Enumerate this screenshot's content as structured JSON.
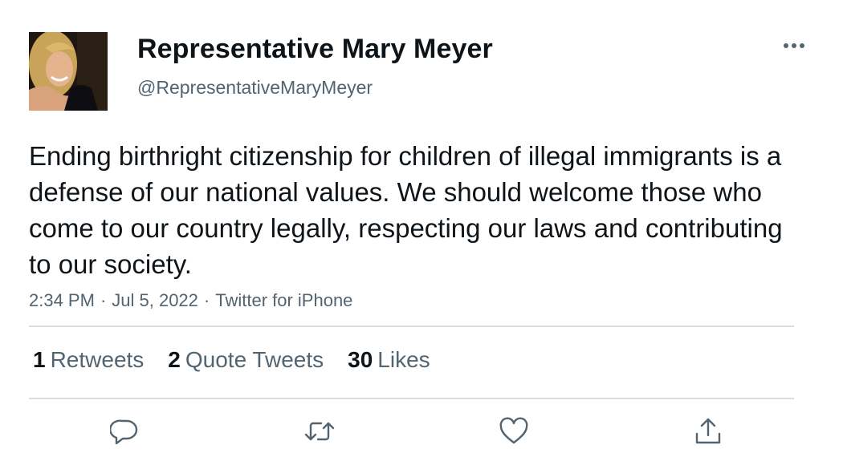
{
  "author": {
    "display_name": "Representative Mary Meyer",
    "handle": "@RepresentativeMaryMeyer",
    "avatar_icon": "profile-photo"
  },
  "tweet": {
    "text": "Ending birthright citizenship for children of illegal immigrants is a defense of our national values. We should welcome those who come to our country legally, respecting our laws and contributing to our society.",
    "time": "2:34 PM",
    "date": "Jul 5, 2022",
    "source": "Twitter for iPhone",
    "separator": "·"
  },
  "stats": {
    "retweets": {
      "count": "1",
      "label": "Retweets"
    },
    "quotes": {
      "count": "2",
      "label": "Quote Tweets"
    },
    "likes": {
      "count": "30",
      "label": "Likes"
    }
  },
  "actions": {
    "reply_icon": "reply-icon",
    "retweet_icon": "retweet-icon",
    "like_icon": "heart-icon",
    "share_icon": "share-icon",
    "more_icon": "more-dots-icon"
  },
  "colors": {
    "text_primary": "#0f1419",
    "text_secondary": "#536471",
    "icon": "#536471",
    "divider": "#d8dcdf"
  }
}
